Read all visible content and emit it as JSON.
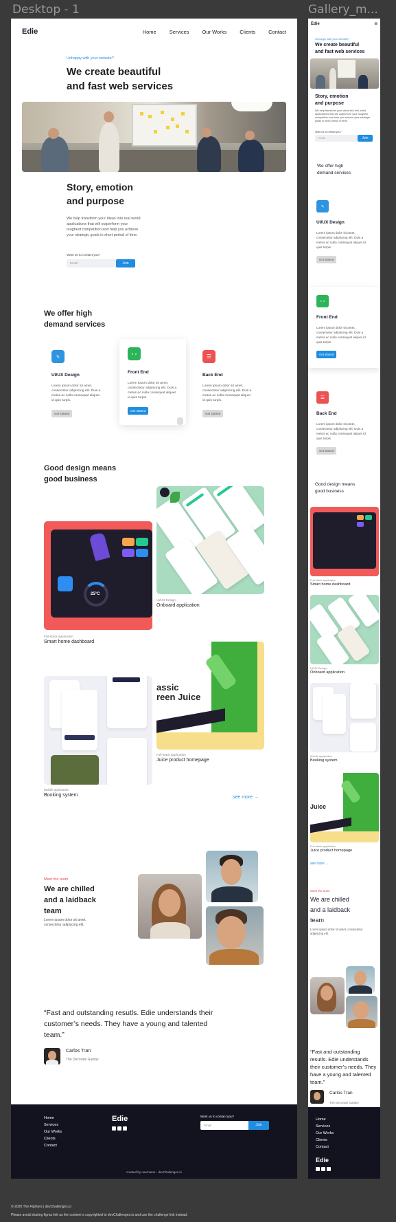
{
  "frames": {
    "desktop_label": "Desktop - 1",
    "mobile_label": "Gallery_m..."
  },
  "nav": {
    "logo": "Edie",
    "links": [
      "Home",
      "Services",
      "Our Works",
      "Clients",
      "Contact"
    ]
  },
  "hero": {
    "eyebrow": "Unhappy with your website?",
    "title_line1": "We create beautiful",
    "title_line2": "and fast web services"
  },
  "story": {
    "title_line1": "Story, emotion",
    "title_line2": "and purpose",
    "body": "We help transform your ideas into real world applications that will outperform your toughest competition and help you achieve your strategic goals in short period of time.",
    "contact_label": "Want us to contact you?",
    "email_placeholder": "Email",
    "join_label": "Join"
  },
  "services": {
    "title_line1": "We offer high",
    "title_line2": "demand services",
    "cards": [
      {
        "title": "UI/UX Design",
        "icon": "pen-icon",
        "glyph": "✎",
        "color": "#2e94e0",
        "desc": "Lorem ipsum dolor sit amet, consectetur adipiscing elit. Duis a metus ac nulla consequat aliquet id quis turpis.",
        "button": "Get started"
      },
      {
        "title": "Front End",
        "icon": "code-icon",
        "glyph": "‹›",
        "color": "#2db35a",
        "desc": "Lorem ipsum dolor sit amet, consectetur adipiscing elit. Duis a metus ac nulla consequat aliquet id quis turpis.",
        "button": "Get started"
      },
      {
        "title": "Back End",
        "icon": "list-icon",
        "glyph": "☰",
        "color": "#ec5252",
        "desc": "Lorem ipsum dolor sit amet, consectetur adipiscing elit. Duis a metus ac nulla consequat aliquet id quis turpis.",
        "button": "Get started"
      }
    ]
  },
  "works": {
    "title_line1": "Good design means",
    "title_line2": "good business",
    "items": [
      {
        "category": "Full-stack application",
        "name": "Smart home dashboard"
      },
      {
        "category": "UI/UX Design",
        "name": "Onboard application"
      },
      {
        "category": "Full-stack application",
        "name": "Juice product homepage"
      },
      {
        "category": "Mobile application",
        "name": "Booking system"
      }
    ],
    "see_more": "see more →",
    "juice_line1": "assic",
    "juice_line2": "reen Juice",
    "juice_line1_m": "Juice",
    "temp": "25°C"
  },
  "team": {
    "eyebrow": "Meet the team",
    "title_line1": "We are chilled",
    "title_line2": "and a laidback",
    "title_line3": "team",
    "body": "Lorem ipsum dolor sit amet, consectetur adipiscing elit."
  },
  "testimonial": {
    "quote": "“Fast and outstanding resutls. Edie understands their customer’s needs. They have a young and talented team.”",
    "name": "Carlos Tran",
    "role": "The Decorate Gatsby"
  },
  "footer": {
    "links": [
      "Home",
      "Services",
      "Our Works",
      "Clients",
      "Contact"
    ],
    "logo": "Edie",
    "contact_label": "Want us to contact you?",
    "email_placeholder": "Email",
    "join_label": "Join",
    "credit": "created by username - devChallenges.io"
  },
  "legal": {
    "line1": "© 2020 The Fighters | devChallenges.io",
    "line2": "Please avoid sharing figma link as the content is copyrighted to devChallenges.io and use the challenge link instead."
  },
  "mobile": {
    "logo": "Edie",
    "menu_icon": "≡"
  }
}
